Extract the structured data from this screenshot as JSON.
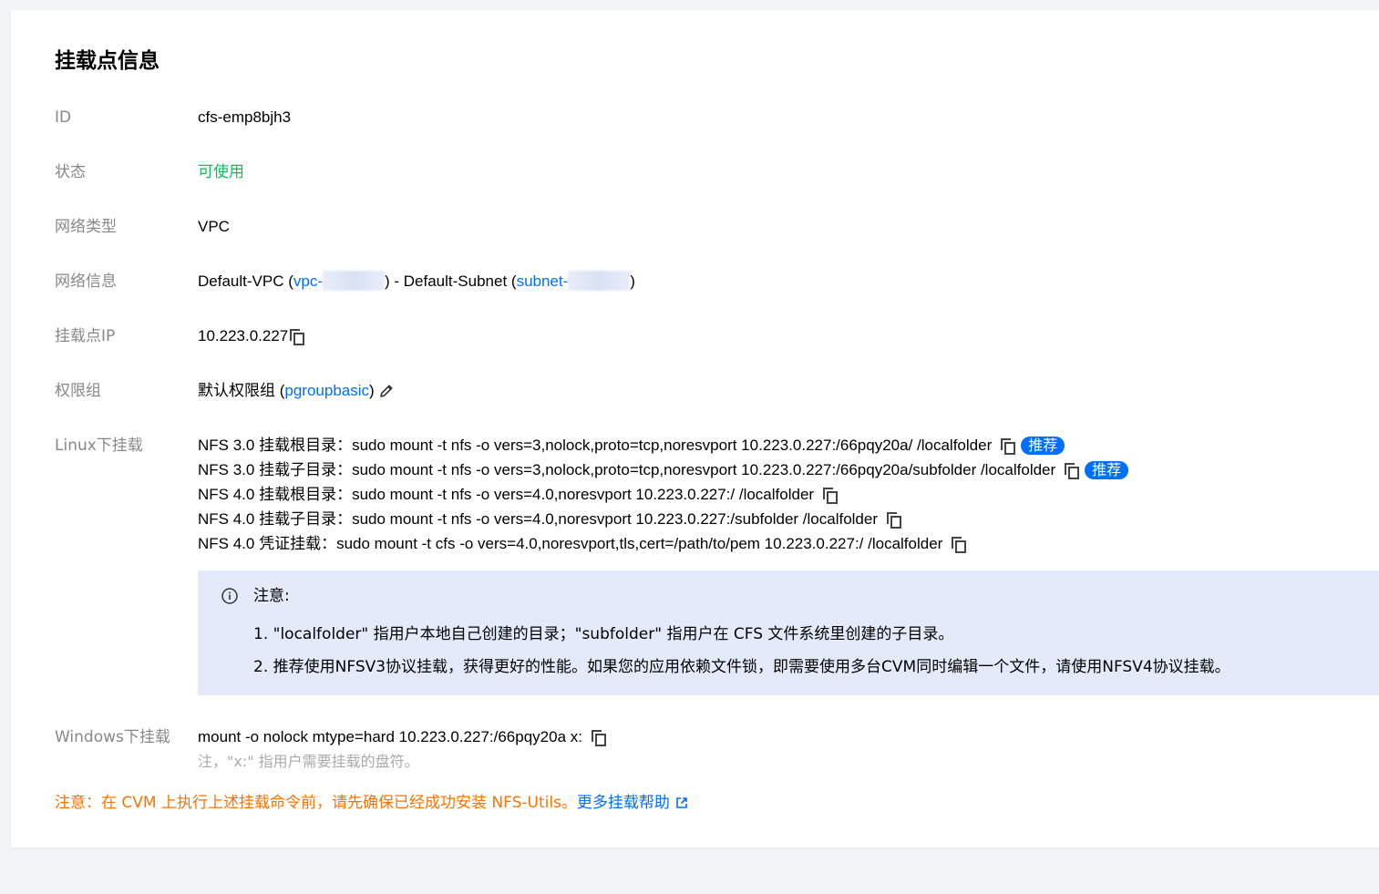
{
  "title": "挂载点信息",
  "rows": {
    "id": {
      "label": "ID",
      "value": "cfs-emp8bjh3"
    },
    "status": {
      "label": "状态",
      "value": "可使用"
    },
    "network_type": {
      "label": "网络类型",
      "value": "VPC"
    },
    "network_info": {
      "label": "网络信息",
      "vpc_name": "Default-VPC (",
      "vpc_link": "vpc-",
      "sep": ") - Default-Subnet (",
      "subnet_link": "subnet-",
      "close": ")"
    },
    "mount_ip": {
      "label": "挂载点IP",
      "value": "10.223.0.227"
    },
    "permission_group": {
      "label": "权限组",
      "name": "默认权限组 (",
      "link": "pgroupbasic",
      "close": ")"
    },
    "linux_mount": {
      "label": "Linux下挂载",
      "commands": [
        {
          "text": "NFS 3.0 挂载根目录：sudo mount -t nfs -o vers=3,nolock,proto=tcp,noresvport 10.223.0.227:/66pqy20a/ /localfolder",
          "badge": "推荐"
        },
        {
          "text": "NFS 3.0 挂载子目录：sudo mount -t nfs -o vers=3,nolock,proto=tcp,noresvport 10.223.0.227:/66pqy20a/subfolder /localfolder",
          "badge": "推荐"
        },
        {
          "text": "NFS 4.0 挂载根目录：sudo mount -t nfs -o vers=4.0,noresvport 10.223.0.227:/ /localfolder"
        },
        {
          "text": "NFS 4.0 挂载子目录：sudo mount -t nfs -o vers=4.0,noresvport 10.223.0.227:/subfolder /localfolder"
        },
        {
          "text": "NFS 4.0 凭证挂载：sudo mount -t cfs -o vers=4.0,noresvport,tls,cert=/path/to/pem 10.223.0.227:/ /localfolder"
        }
      ]
    },
    "notice": {
      "title": "注意:",
      "items": [
        "1. \"localfolder\" 指用户本地自己创建的目录；\"subfolder\" 指用户在 CFS 文件系统里创建的子目录。",
        "2. 推荐使用NFSV3协议挂载，获得更好的性能。如果您的应用依赖文件锁，即需要使用多台CVM同时编辑一个文件，请使用NFSV4协议挂载。"
      ]
    },
    "windows_mount": {
      "label": "Windows下挂载",
      "command": "mount -o nolock mtype=hard 10.223.0.227:/66pqy20a x:",
      "hint": "注，\"x:\" 指用户需要挂载的盘符。"
    }
  },
  "warning": {
    "text": "注意：在 CVM 上执行上述挂载命令前，请先确保已经成功安装 NFS-Utils。",
    "link": "更多挂载帮助"
  },
  "colors": {
    "accent": "#006eff",
    "success": "#0abf5b",
    "warning": "#ff7200",
    "notice_bg": "#e3ebfb"
  }
}
